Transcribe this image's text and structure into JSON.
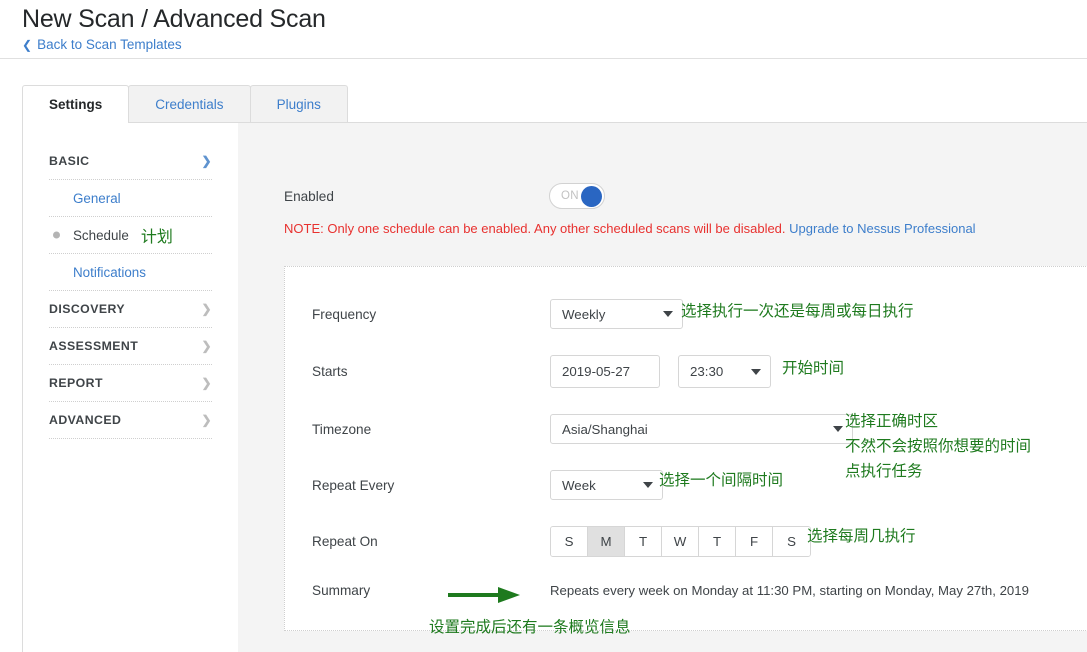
{
  "header": {
    "title": "New Scan / Advanced Scan",
    "back_link": "Back to Scan Templates",
    "back_icon": "chevron-left-icon"
  },
  "tabs": [
    {
      "label": "Settings",
      "active": true
    },
    {
      "label": "Credentials",
      "active": false
    },
    {
      "label": "Plugins",
      "active": false
    }
  ],
  "sidebar": {
    "groups": [
      {
        "label": "BASIC",
        "expanded": true,
        "icon": "chevron-down-icon"
      },
      {
        "label": "DISCOVERY",
        "expanded": false,
        "icon": "chevron-right-icon"
      },
      {
        "label": "ASSESSMENT",
        "expanded": false,
        "icon": "chevron-right-icon"
      },
      {
        "label": "REPORT",
        "expanded": false,
        "icon": "chevron-right-icon"
      },
      {
        "label": "ADVANCED",
        "expanded": false,
        "icon": "chevron-right-icon"
      }
    ],
    "basic_items": [
      {
        "label": "General",
        "current": false
      },
      {
        "label": "Schedule",
        "current": true,
        "annotation": "计划"
      },
      {
        "label": "Notifications",
        "current": false
      }
    ]
  },
  "main": {
    "enabled": {
      "label": "Enabled",
      "toggle_state": "ON"
    },
    "note": {
      "text": "NOTE: Only one schedule can be enabled. Any other scheduled scans will be disabled. ",
      "link": "Upgrade to Nessus Professional"
    },
    "fields": {
      "frequency": {
        "label": "Frequency",
        "value": "Weekly"
      },
      "starts": {
        "label": "Starts",
        "date": "2019-05-27",
        "time": "23:30"
      },
      "timezone": {
        "label": "Timezone",
        "value": "Asia/Shanghai"
      },
      "repeat_every": {
        "label": "Repeat Every",
        "value": "Week"
      },
      "repeat_on": {
        "label": "Repeat On",
        "days": [
          {
            "label": "S",
            "selected": false
          },
          {
            "label": "M",
            "selected": true
          },
          {
            "label": "T",
            "selected": false
          },
          {
            "label": "W",
            "selected": false
          },
          {
            "label": "T",
            "selected": false
          },
          {
            "label": "F",
            "selected": false
          },
          {
            "label": "S",
            "selected": false
          }
        ]
      },
      "summary": {
        "label": "Summary",
        "value": "Repeats every week on Monday at 11:30 PM, starting on Monday, May 27th, 2019"
      }
    }
  },
  "annotations": {
    "frequency": "选择执行一次还是每周或每日执行",
    "starts": "开始时间",
    "timezone_line1": "选择正确时区",
    "timezone_line2": "不然不会按照你想要的时间",
    "timezone_line3": "点执行任务",
    "repeat_every": "选择一个间隔时间",
    "repeat_on": "选择每周几执行",
    "summary": "设置完成后还有一条概览信息"
  },
  "colors": {
    "annotation_green": "#1e7a1e",
    "link_blue": "#3d7ecb",
    "note_red": "#e8312f",
    "toggle_on": "#2a66c2"
  }
}
